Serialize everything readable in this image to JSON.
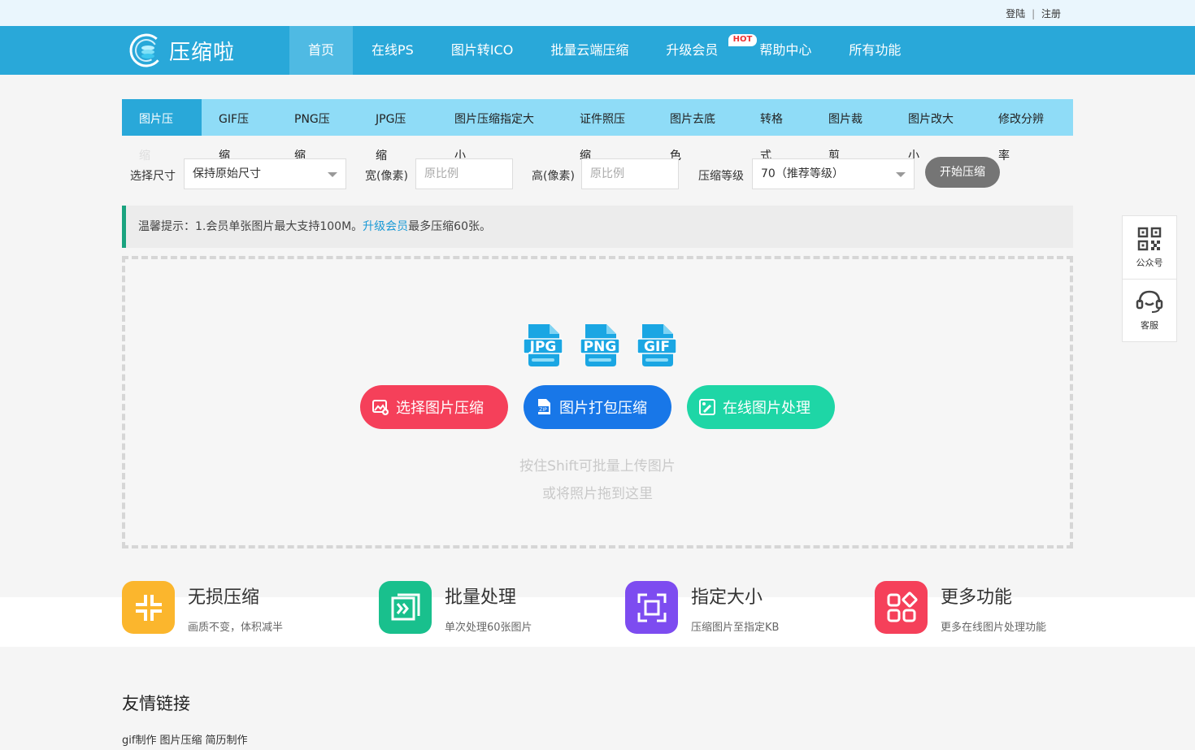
{
  "auth": {
    "login": "登陆",
    "separator": "|",
    "register": "注册"
  },
  "brand": {
    "name": "压缩啦"
  },
  "nav": [
    {
      "label": "首页",
      "active": true
    },
    {
      "label": "在线PS"
    },
    {
      "label": "图片转ICO"
    },
    {
      "label": "批量云端压缩"
    },
    {
      "label": "升级会员",
      "badge": "HOT"
    },
    {
      "label": "帮助中心"
    },
    {
      "label": "所有功能"
    }
  ],
  "tabs": [
    {
      "line1": "图片压",
      "line2": "缩",
      "active": true
    },
    {
      "line1": "GIF压",
      "line2": "缩"
    },
    {
      "line1": "PNG压",
      "line2": "缩"
    },
    {
      "line1": "JPG压",
      "line2": "缩"
    },
    {
      "line1": "图片压缩指定大",
      "line2": "小"
    },
    {
      "line1": "证件照压",
      "line2": "缩"
    },
    {
      "line1": "图片去底",
      "line2": "色"
    },
    {
      "line1": "转格",
      "line2": "式"
    },
    {
      "line1": "图片裁",
      "line2": "剪"
    },
    {
      "line1": "图片改大",
      "line2": "小"
    },
    {
      "line1": "修改分辨",
      "line2": "率"
    }
  ],
  "options": {
    "size_label": "选择尺寸",
    "size_value": "保持原始尺寸",
    "width_label": "宽(像素)",
    "width_placeholder": "原比例",
    "height_label": "高(像素)",
    "height_placeholder": "原比例",
    "level_label": "压缩等级",
    "level_value": "70（推荐等级）",
    "start_button": "开始压缩"
  },
  "tip": {
    "prefix": "温馨提示：1.会员单张图片最大支持100M。",
    "link": "升级会员",
    "suffix": "最多压缩60张。"
  },
  "upload": {
    "file_types": [
      "JPG",
      "PNG",
      "GIF"
    ],
    "buttons": {
      "select": "选择图片压缩",
      "zip": "图片打包压缩",
      "online": "在线图片处理"
    },
    "hint1": "按住Shift可批量上传图片",
    "hint2": "或将照片拖到这里"
  },
  "features": [
    {
      "title": "无损压缩",
      "desc": "画质不变，体积减半",
      "color": "#fbb62d"
    },
    {
      "title": "批量处理",
      "desc": "单次处理60张图片",
      "color": "#19c08d"
    },
    {
      "title": "指定大小",
      "desc": "压缩图片至指定KB",
      "color": "#7d4cf0"
    },
    {
      "title": "更多功能",
      "desc": "更多在线图片处理功能",
      "color": "#f5405a"
    }
  ],
  "friend": {
    "title": "友情链接",
    "links": [
      "gif制作",
      "图片压缩",
      "简历制作"
    ]
  },
  "side": {
    "qr_label": "公众号",
    "service_label": "客服"
  },
  "colors": {
    "primary": "#29a8d9",
    "tabs_bg": "#8fdcf7",
    "tip_accent": "#1aa37f",
    "file_icon": "#1aa6e3"
  }
}
